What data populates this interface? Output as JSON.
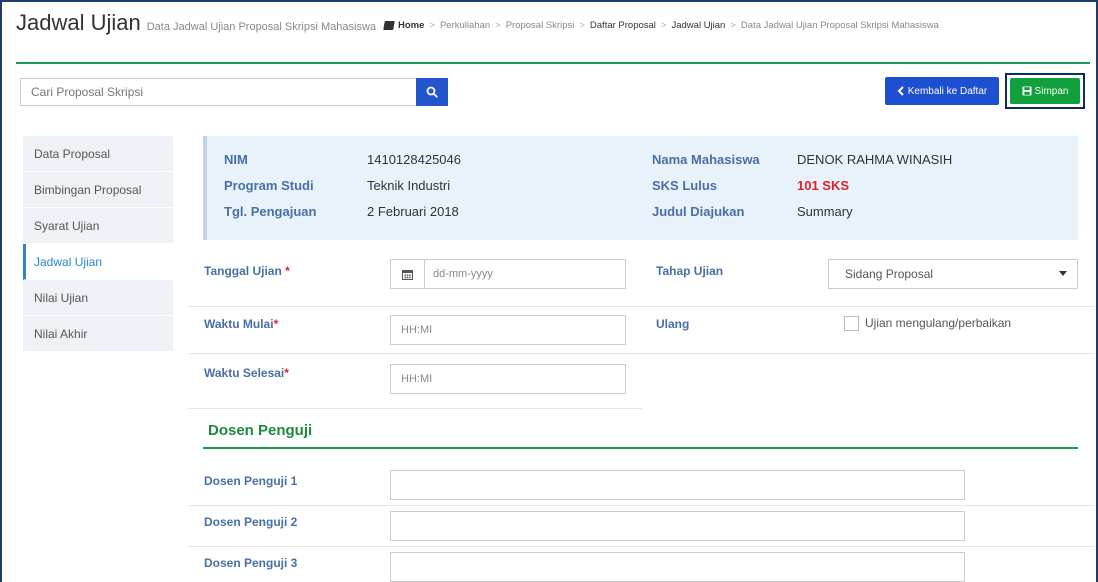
{
  "header": {
    "title": "Jadwal Ujian",
    "subtitle": "Data Jadwal Ujian Proposal Skripsi Mahasiswa",
    "breadcrumb": [
      "Home",
      "Perkuliahan",
      "Proposal Skripsi",
      "Daftar Proposal",
      "Jadwal Ujian",
      "Data Jadwal Ujian Proposal Skripsi Mahasiswa"
    ]
  },
  "search": {
    "placeholder": "Cari Proposal Skripsi",
    "icon": "search-icon"
  },
  "toolbar": {
    "back_label": "Kembali ke Daftar",
    "save_label": "Simpan"
  },
  "sidebar": {
    "items": [
      {
        "label": "Data Proposal",
        "active": false
      },
      {
        "label": "Bimbingan Proposal",
        "active": false
      },
      {
        "label": "Syarat Ujian",
        "active": false
      },
      {
        "label": "Jadwal Ujian",
        "active": true
      },
      {
        "label": "Nilai Ujian",
        "active": false
      },
      {
        "label": "Nilai Akhir",
        "active": false
      }
    ]
  },
  "student": {
    "nim_label": "NIM",
    "nim": "1410128425046",
    "prodi_label": "Program Studi",
    "prodi": "Teknik Industri",
    "tgl_label": "Tgl. Pengajuan",
    "tgl": "2 Februari 2018",
    "nama_label": "Nama Mahasiswa",
    "nama": "DENOK RAHMA WINASIH",
    "sks_label": "SKS Lulus",
    "sks": "101 SKS",
    "judul_label": "Judul Diajukan",
    "judul": "Summary"
  },
  "form": {
    "tanggal_label": "Tanggal Ujian",
    "tanggal_placeholder": "dd-mm-yyyy",
    "tahap_label": "Tahap Ujian",
    "tahap_value": "Sidang Proposal",
    "waktu_mulai_label": "Waktu Mulai",
    "waktu_mulai_placeholder": "HH:MI",
    "ulang_label": "Ulang",
    "ulang_checkbox_label": "Ujian mengulang/perbaikan",
    "waktu_selesai_label": "Waktu Selesai",
    "waktu_selesai_placeholder": "HH:MI",
    "required_mark": "*"
  },
  "dosen": {
    "section_title": "Dosen Penguji",
    "items": [
      {
        "label": "Dosen Penguji 1",
        "value": ""
      },
      {
        "label": "Dosen Penguji 2",
        "value": ""
      },
      {
        "label": "Dosen Penguji 3",
        "value": ""
      }
    ]
  },
  "colors": {
    "primary_blue": "#1f4fd1",
    "success_green": "#11a03c",
    "label_blue": "#4a6fa5",
    "danger_red": "#e0212b",
    "active_link": "#2c84d4"
  }
}
